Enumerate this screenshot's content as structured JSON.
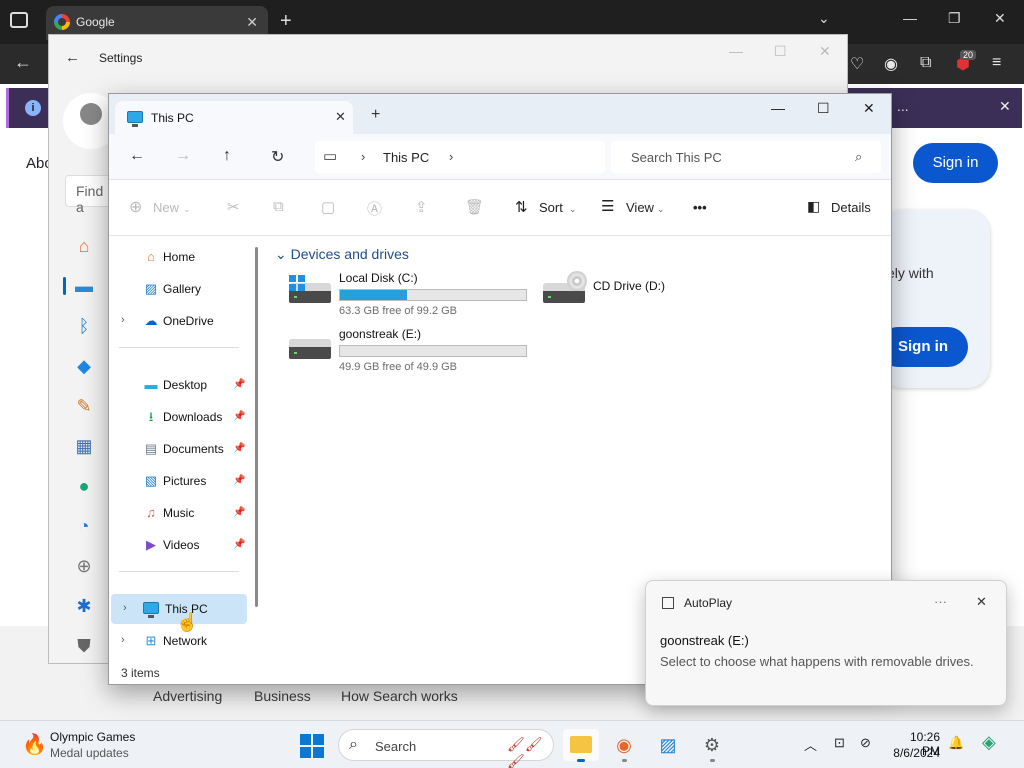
{
  "browser": {
    "tab_title": "Google",
    "about_text": "Abo",
    "signin_top": "Sign in",
    "card_text": "ely with",
    "signin_card": "Sign in",
    "ext_badge": "20",
    "info_dots": "...",
    "footer_links": [
      "Advertising",
      "Business",
      "How Search works"
    ]
  },
  "settings": {
    "title": "Settings",
    "find_placeholder": "Find a",
    "nav_icons": [
      "home-icon",
      "system-icon",
      "bluetooth-icon",
      "network-icon",
      "personalization-icon",
      "apps-icon",
      "accounts-icon",
      "time-icon",
      "gaming-icon",
      "accessibility-icon",
      "privacy-icon"
    ]
  },
  "explorer": {
    "tab_title": "This PC",
    "address": "This PC",
    "search_placeholder": "Search This PC",
    "commands": {
      "new": "New",
      "sort": "Sort",
      "view": "View",
      "more": "•••",
      "details": "Details"
    },
    "sidebar": {
      "items": [
        {
          "label": "Home",
          "icon": "home-icon",
          "pinned": false,
          "expandable": false
        },
        {
          "label": "Gallery",
          "icon": "gallery-icon",
          "pinned": false,
          "expandable": false
        },
        {
          "label": "OneDrive",
          "icon": "cloud-icon",
          "pinned": false,
          "expandable": true
        },
        {
          "label": "Desktop",
          "icon": "desktop-icon",
          "pinned": true,
          "expandable": false
        },
        {
          "label": "Downloads",
          "icon": "download-icon",
          "pinned": true,
          "expandable": false
        },
        {
          "label": "Documents",
          "icon": "documents-icon",
          "pinned": true,
          "expandable": false
        },
        {
          "label": "Pictures",
          "icon": "pictures-icon",
          "pinned": true,
          "expandable": false
        },
        {
          "label": "Music",
          "icon": "music-icon",
          "pinned": true,
          "expandable": false
        },
        {
          "label": "Videos",
          "icon": "videos-icon",
          "pinned": true,
          "expandable": false
        },
        {
          "label": "This PC",
          "icon": "this-pc-icon",
          "pinned": false,
          "expandable": true,
          "selected": true
        },
        {
          "label": "Network",
          "icon": "network-icon",
          "pinned": false,
          "expandable": true
        }
      ]
    },
    "group_header": "Devices and drives",
    "drives": [
      {
        "name": "Local Disk (C:)",
        "free_text": "63.3 GB free of 99.2 GB",
        "used_fraction": 0.362
      },
      {
        "name": "CD Drive (D:)"
      },
      {
        "name": "goonstreak (E:)",
        "free_text": "49.9 GB free of 49.9 GB",
        "used_fraction": 0.0
      }
    ],
    "status": "3 items"
  },
  "toast": {
    "app": "AutoPlay",
    "more": "···",
    "title": "goonstreak (E:)",
    "body": "Select to choose what happens with removable drives."
  },
  "taskbar": {
    "widget_title": "Olympic Games",
    "widget_sub": "Medal updates",
    "search": "Search",
    "time": "10:26 PM",
    "date": "8/6/2024"
  }
}
